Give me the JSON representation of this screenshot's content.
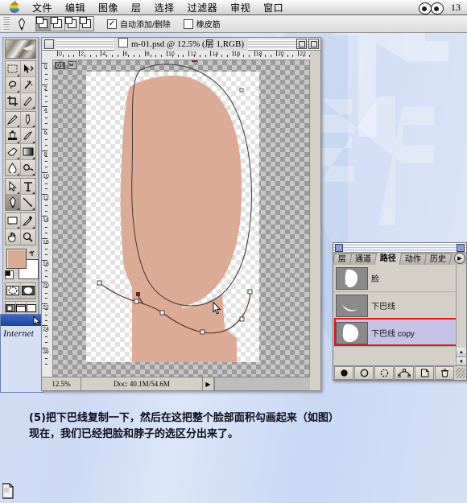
{
  "menubar": {
    "apple_icon": "apple-logo",
    "items": [
      "文件",
      "编辑",
      "图像",
      "层",
      "选择",
      "过滤器",
      "审视",
      "窗口"
    ],
    "eyes_icon": "eyes-icon",
    "page_number": "13"
  },
  "options_bar": {
    "tool_icon": "pen-tool-icon",
    "modes": [
      "add-to-shape",
      "subtract-from-shape",
      "intersect-shape",
      "exclude-shape"
    ],
    "selected_mode_index": 0,
    "checkboxes": [
      {
        "label": "自动添加/删除",
        "checked": true,
        "mark": "✓"
      },
      {
        "label": "橡皮筋",
        "checked": false,
        "mark": ""
      }
    ]
  },
  "toolbox": {
    "banner_icon": "photoshop-banner",
    "tools": [
      [
        "marquee-tool",
        "move-tool"
      ],
      [
        "lasso-tool",
        "magic-wand-tool"
      ],
      [
        "crop-tool",
        "slice-tool"
      ],
      [
        "airbrush-tool",
        "paintbrush-tool"
      ],
      [
        "stamp-tool",
        "history-brush-tool"
      ],
      [
        "eraser-tool",
        "gradient-tool"
      ],
      [
        "blur-tool",
        "dodge-tool"
      ],
      [
        "path-selection-tool",
        "type-tool"
      ],
      [
        "pen-tool",
        "line-tool"
      ],
      [
        "notes-tool",
        "eyedropper-tool"
      ],
      [
        "hand-tool",
        "zoom-tool"
      ]
    ],
    "active_tool": "pen-tool",
    "foreground_color": "#dcab95",
    "background_color": "#ffffff",
    "mask_modes": [
      "standard-mask-mode",
      "quick-mask-mode"
    ],
    "screen_modes": [
      "standard-screen-mode",
      "full-screen-menubar-mode",
      "full-screen-mode"
    ],
    "jump_buttons": [
      "jump-to-imageready",
      "jump-to-preview"
    ]
  },
  "document": {
    "title": "m-01.psd @ 12.5% (层 1,RGB)",
    "close_icon": "close-box-icon",
    "min_icon": "zoom-box-icon",
    "max_icon": "collapse-box-icon",
    "layer_badge": "01",
    "zoom_level": "12.5%",
    "doc_info": "Doc: 40.1M/54.6M",
    "info_arrow": "▶",
    "ruler_unit_labels_h": [
      "0",
      "2",
      "4",
      "6",
      "8",
      "10",
      "12",
      "14",
      "16",
      "18",
      "20",
      "22"
    ],
    "ruler_unit_labels_v": [
      "0",
      "2",
      "4",
      "6",
      "8",
      "10",
      "12",
      "14",
      "16",
      "18",
      "20",
      "22",
      "24",
      "26"
    ],
    "canvas": {
      "skin_color": "#dcab95",
      "path_stroke": "#4a4a4a",
      "active_path_stroke": "#5c2a18",
      "anchor_fill": "#ffffff",
      "cursor_icon": "arrow-cursor"
    }
  },
  "palette": {
    "window_icon": "palette-window-icon",
    "tabs": [
      {
        "label": "层",
        "active": false
      },
      {
        "label": "通道",
        "active": false
      },
      {
        "label": "路径",
        "active": true
      },
      {
        "label": "动作",
        "active": false
      },
      {
        "label": "历史",
        "active": false
      }
    ],
    "more_icon": "palette-menu-icon",
    "rows": [
      {
        "label": "脸",
        "selected": false,
        "thumb": "face-path-thumb"
      },
      {
        "label": "下巴线",
        "selected": false,
        "thumb": "jawline-path-thumb"
      },
      {
        "label": "下巴线 copy",
        "selected": true,
        "thumb": "jawline-copy-path-thumb"
      }
    ],
    "selection_highlight_color": "#e81313",
    "bottom_buttons": [
      "fill-path-icon",
      "stroke-path-icon",
      "load-path-as-selection-icon",
      "make-work-path-icon",
      "new-path-icon",
      "delete-path-icon"
    ],
    "scroll_up_icon": "▲",
    "scroll_down_icon": "▼",
    "resize_grip": "resize-grip-icon"
  },
  "ie_fragment": {
    "label": "Internet",
    "arrow_icon": "cursor-arrow-icon"
  },
  "caption": {
    "line1": "(5)把下巴线复制一下，然后在这把整个脸部面积勾画起来（如图）",
    "line2": "现在，我们已经把脸和脖子的选区分出来了。"
  },
  "bottom_icon": {
    "name": "document-file-icon"
  }
}
